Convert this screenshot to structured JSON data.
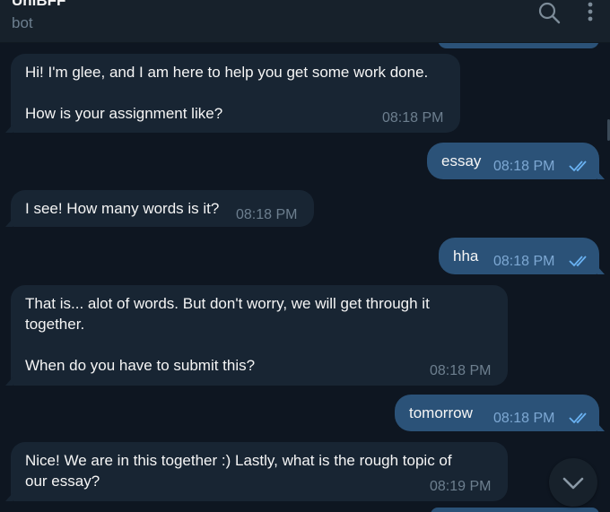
{
  "header": {
    "title": "UniBFF",
    "subtitle": "bot",
    "search_icon": "search-icon",
    "menu_icon": "more-vertical-icon"
  },
  "messages": [
    {
      "dir": "in",
      "text": "Hi! I'm glee, and I am here to help you get some work done.\n\nHow is your assignment like?",
      "time": "08:18 PM"
    },
    {
      "dir": "out",
      "text": "essay",
      "time": "08:18 PM",
      "read": true
    },
    {
      "dir": "in",
      "text": "I see! How many words is it?",
      "time": "08:18 PM"
    },
    {
      "dir": "out",
      "text": "hha",
      "time": "08:18 PM",
      "read": true
    },
    {
      "dir": "in",
      "text": "That is... alot of words. But don't worry, we will get through it\ntogether.\n\nWhen do you have to submit this?",
      "time": "08:18 PM"
    },
    {
      "dir": "out",
      "text": "tomorrow",
      "time": "08:18 PM",
      "read": true
    },
    {
      "dir": "in",
      "text": "Nice! We are in this together :) Lastly, what is the rough topic of\nour essay?",
      "time": "08:19 PM"
    }
  ],
  "scroll_down_icon": "chevron-down-icon",
  "colors": {
    "background": "#0e1621",
    "header": "#17212b",
    "incoming_bubble": "#182533",
    "outgoing_bubble": "#2b5278",
    "timestamp": "#6d7f8f",
    "read_ticks": "#6ab2f2"
  }
}
